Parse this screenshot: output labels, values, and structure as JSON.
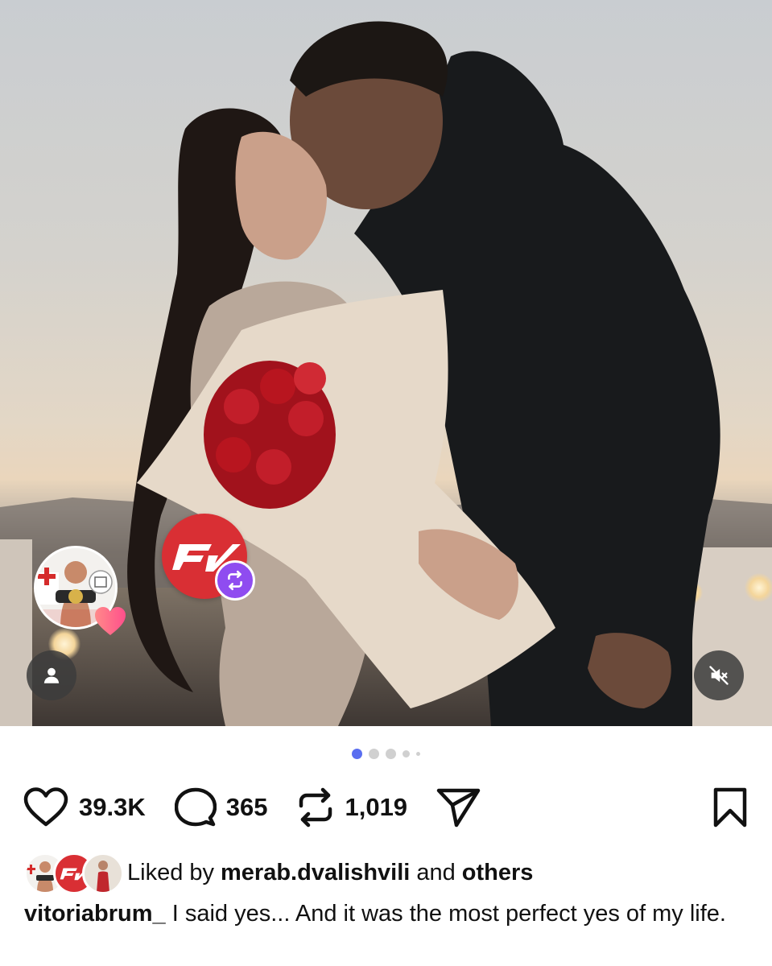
{
  "post": {
    "media_dots": {
      "count": 5,
      "active_index": 0
    },
    "tagged_avatar_icon": "champion-avatar-icon",
    "reposter_logo_text": "FV"
  },
  "actions": {
    "likes": "39.3K",
    "comments": "365",
    "reposts": "1,019"
  },
  "liked_by": {
    "prefix": "Liked by",
    "user": "merab.dvalishvili",
    "joiner": "and",
    "others": "others"
  },
  "caption": {
    "username": "vitoriabrum_",
    "text": "I said yes... And it was the most perfect yes of my life."
  },
  "colors": {
    "accent": "#5a6ef0",
    "repost_badge": "#8f4cf0",
    "fv_red": "#d92f34",
    "heart": "#ff5a7a"
  }
}
